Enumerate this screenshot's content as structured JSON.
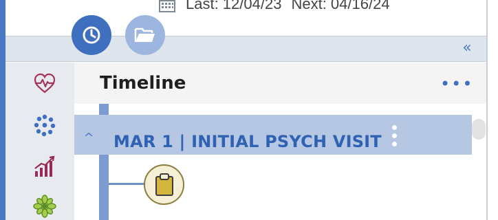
{
  "header": {
    "last_visit": "Last: 12/04/23",
    "next_visit": "Next: 04/16/24"
  },
  "toolbar": {
    "timeline_button": "clock-icon",
    "folder_button": "folder-icon",
    "collapse_icon": "double-chevron-left-icon",
    "collapse_glyph": "«"
  },
  "sidebar": {
    "icons": [
      "heartbeat-icon",
      "dots-circle-icon",
      "trend-chart-icon",
      "flower-icon"
    ]
  },
  "timeline": {
    "title": "Timeline",
    "more_glyph": "•••",
    "entries": [
      {
        "toggle_glyph": "^",
        "title": "MAR 1 | INITIAL PSYCH VISIT",
        "node_icon": "clipboard-icon"
      }
    ]
  },
  "colors": {
    "accent": "#3f6fbf",
    "accent_light": "#9db6e0",
    "visit_bar": "#b5c7e2",
    "visit_text": "#2f62b3",
    "heart": "#a2355c",
    "rail_green": "#5a8d25",
    "clipboard": "#d4b63f"
  }
}
